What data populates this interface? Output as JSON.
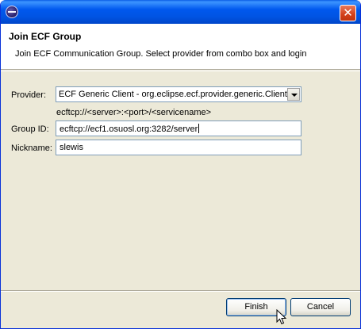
{
  "window": {
    "title": ""
  },
  "header": {
    "title": "Join ECF Group",
    "description": "Join ECF Communication Group.  Select provider from combo box and login"
  },
  "form": {
    "provider_label": "Provider:",
    "provider_value": "ECF Generic Client - org.eclipse.ecf.provider.generic.Client",
    "hint": "ecftcp://<server>:<port>/<servicename>",
    "group_label": "Group ID:",
    "group_value": "ecftcp://ecf1.osuosl.org:3282/server",
    "nickname_label": "Nickname:",
    "nickname_value": "slewis"
  },
  "buttons": {
    "finish": "Finish",
    "cancel": "Cancel"
  },
  "icons": {
    "app": "eclipse-icon",
    "close": "close-icon",
    "dropdown": "chevron-down-icon",
    "cursor": "mouse-pointer-icon"
  }
}
